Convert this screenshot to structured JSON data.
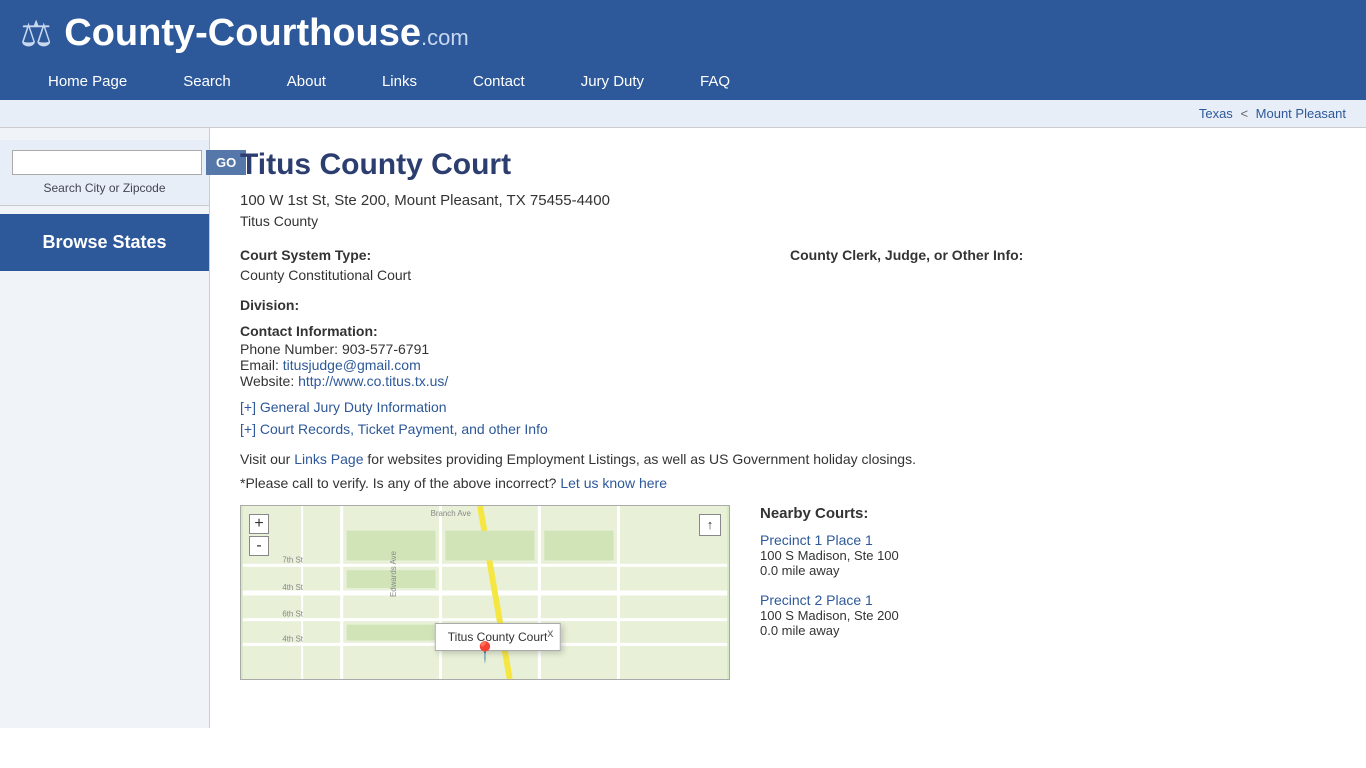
{
  "header": {
    "logo_main": "County-Courthouse",
    "logo_com": ".com",
    "nav": [
      {
        "label": "Home Page",
        "id": "home"
      },
      {
        "label": "Search",
        "id": "search"
      },
      {
        "label": "About",
        "id": "about"
      },
      {
        "label": "Links",
        "id": "links"
      },
      {
        "label": "Contact",
        "id": "contact"
      },
      {
        "label": "Jury Duty",
        "id": "jury-duty"
      },
      {
        "label": "FAQ",
        "id": "faq"
      }
    ]
  },
  "breadcrumb": {
    "state": "Texas",
    "city": "Mount Pleasant",
    "separator": "<"
  },
  "sidebar": {
    "search_placeholder": "",
    "go_label": "GO",
    "search_label": "Search City or Zipcode",
    "browse_states": "Browse States"
  },
  "court": {
    "title": "Titus County Court",
    "address": "100 W 1st St, Ste 200, Mount Pleasant, TX 75455-4400",
    "county": "Titus County",
    "court_system_label": "Court System Type:",
    "court_system_value": "County Constitutional Court",
    "clerk_label": "County Clerk, Judge, or Other Info:",
    "division_label": "Division:",
    "division_value": "",
    "contact_label": "Contact Information:",
    "phone_label": "Phone Number:",
    "phone_value": "903-577-6791",
    "email_label": "Email:",
    "email_value": "titusjudge@gmail.com",
    "website_label": "Website:",
    "website_value": "http://www.co.titus.tx.us/",
    "jury_duty_link": "[+] General Jury Duty Information",
    "court_records_link": "[+] Court Records, Ticket Payment, and other Info",
    "visit_text_1": "Visit our",
    "links_page_label": "Links Page",
    "visit_text_2": "for websites providing Employment Listings, as well as US Government holiday closings.",
    "verify_text": "*Please call to verify. Is any of the above incorrect?",
    "let_us_know": "Let us know here"
  },
  "map": {
    "popup_text": "Titus County Court",
    "popup_close": "x",
    "zoom_plus": "+",
    "zoom_minus": "-"
  },
  "nearby_courts": {
    "title": "Nearby Courts:",
    "courts": [
      {
        "name": "Precinct 1 Place 1",
        "address": "100 S Madison, Ste 100",
        "distance": "0.0 mile away"
      },
      {
        "name": "Precinct 2 Place 1",
        "address": "100 S Madison, Ste 200",
        "distance": "0.0 mile away"
      }
    ]
  }
}
